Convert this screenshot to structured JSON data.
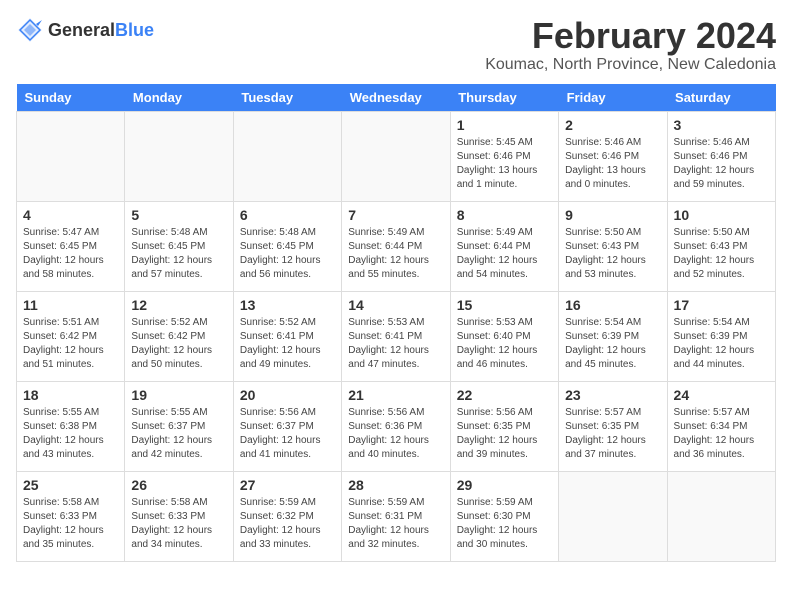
{
  "logo": {
    "general": "General",
    "blue": "Blue"
  },
  "header": {
    "month_year": "February 2024",
    "location": "Koumac, North Province, New Caledonia"
  },
  "days_of_week": [
    "Sunday",
    "Monday",
    "Tuesday",
    "Wednesday",
    "Thursday",
    "Friday",
    "Saturday"
  ],
  "weeks": [
    [
      {
        "day": "",
        "info": ""
      },
      {
        "day": "",
        "info": ""
      },
      {
        "day": "",
        "info": ""
      },
      {
        "day": "",
        "info": ""
      },
      {
        "day": "1",
        "info": "Sunrise: 5:45 AM\nSunset: 6:46 PM\nDaylight: 13 hours\nand 1 minute."
      },
      {
        "day": "2",
        "info": "Sunrise: 5:46 AM\nSunset: 6:46 PM\nDaylight: 13 hours\nand 0 minutes."
      },
      {
        "day": "3",
        "info": "Sunrise: 5:46 AM\nSunset: 6:46 PM\nDaylight: 12 hours\nand 59 minutes."
      }
    ],
    [
      {
        "day": "4",
        "info": "Sunrise: 5:47 AM\nSunset: 6:45 PM\nDaylight: 12 hours\nand 58 minutes."
      },
      {
        "day": "5",
        "info": "Sunrise: 5:48 AM\nSunset: 6:45 PM\nDaylight: 12 hours\nand 57 minutes."
      },
      {
        "day": "6",
        "info": "Sunrise: 5:48 AM\nSunset: 6:45 PM\nDaylight: 12 hours\nand 56 minutes."
      },
      {
        "day": "7",
        "info": "Sunrise: 5:49 AM\nSunset: 6:44 PM\nDaylight: 12 hours\nand 55 minutes."
      },
      {
        "day": "8",
        "info": "Sunrise: 5:49 AM\nSunset: 6:44 PM\nDaylight: 12 hours\nand 54 minutes."
      },
      {
        "day": "9",
        "info": "Sunrise: 5:50 AM\nSunset: 6:43 PM\nDaylight: 12 hours\nand 53 minutes."
      },
      {
        "day": "10",
        "info": "Sunrise: 5:50 AM\nSunset: 6:43 PM\nDaylight: 12 hours\nand 52 minutes."
      }
    ],
    [
      {
        "day": "11",
        "info": "Sunrise: 5:51 AM\nSunset: 6:42 PM\nDaylight: 12 hours\nand 51 minutes."
      },
      {
        "day": "12",
        "info": "Sunrise: 5:52 AM\nSunset: 6:42 PM\nDaylight: 12 hours\nand 50 minutes."
      },
      {
        "day": "13",
        "info": "Sunrise: 5:52 AM\nSunset: 6:41 PM\nDaylight: 12 hours\nand 49 minutes."
      },
      {
        "day": "14",
        "info": "Sunrise: 5:53 AM\nSunset: 6:41 PM\nDaylight: 12 hours\nand 47 minutes."
      },
      {
        "day": "15",
        "info": "Sunrise: 5:53 AM\nSunset: 6:40 PM\nDaylight: 12 hours\nand 46 minutes."
      },
      {
        "day": "16",
        "info": "Sunrise: 5:54 AM\nSunset: 6:39 PM\nDaylight: 12 hours\nand 45 minutes."
      },
      {
        "day": "17",
        "info": "Sunrise: 5:54 AM\nSunset: 6:39 PM\nDaylight: 12 hours\nand 44 minutes."
      }
    ],
    [
      {
        "day": "18",
        "info": "Sunrise: 5:55 AM\nSunset: 6:38 PM\nDaylight: 12 hours\nand 43 minutes."
      },
      {
        "day": "19",
        "info": "Sunrise: 5:55 AM\nSunset: 6:37 PM\nDaylight: 12 hours\nand 42 minutes."
      },
      {
        "day": "20",
        "info": "Sunrise: 5:56 AM\nSunset: 6:37 PM\nDaylight: 12 hours\nand 41 minutes."
      },
      {
        "day": "21",
        "info": "Sunrise: 5:56 AM\nSunset: 6:36 PM\nDaylight: 12 hours\nand 40 minutes."
      },
      {
        "day": "22",
        "info": "Sunrise: 5:56 AM\nSunset: 6:35 PM\nDaylight: 12 hours\nand 39 minutes."
      },
      {
        "day": "23",
        "info": "Sunrise: 5:57 AM\nSunset: 6:35 PM\nDaylight: 12 hours\nand 37 minutes."
      },
      {
        "day": "24",
        "info": "Sunrise: 5:57 AM\nSunset: 6:34 PM\nDaylight: 12 hours\nand 36 minutes."
      }
    ],
    [
      {
        "day": "25",
        "info": "Sunrise: 5:58 AM\nSunset: 6:33 PM\nDaylight: 12 hours\nand 35 minutes."
      },
      {
        "day": "26",
        "info": "Sunrise: 5:58 AM\nSunset: 6:33 PM\nDaylight: 12 hours\nand 34 minutes."
      },
      {
        "day": "27",
        "info": "Sunrise: 5:59 AM\nSunset: 6:32 PM\nDaylight: 12 hours\nand 33 minutes."
      },
      {
        "day": "28",
        "info": "Sunrise: 5:59 AM\nSunset: 6:31 PM\nDaylight: 12 hours\nand 32 minutes."
      },
      {
        "day": "29",
        "info": "Sunrise: 5:59 AM\nSunset: 6:30 PM\nDaylight: 12 hours\nand 30 minutes."
      },
      {
        "day": "",
        "info": ""
      },
      {
        "day": "",
        "info": ""
      }
    ]
  ]
}
